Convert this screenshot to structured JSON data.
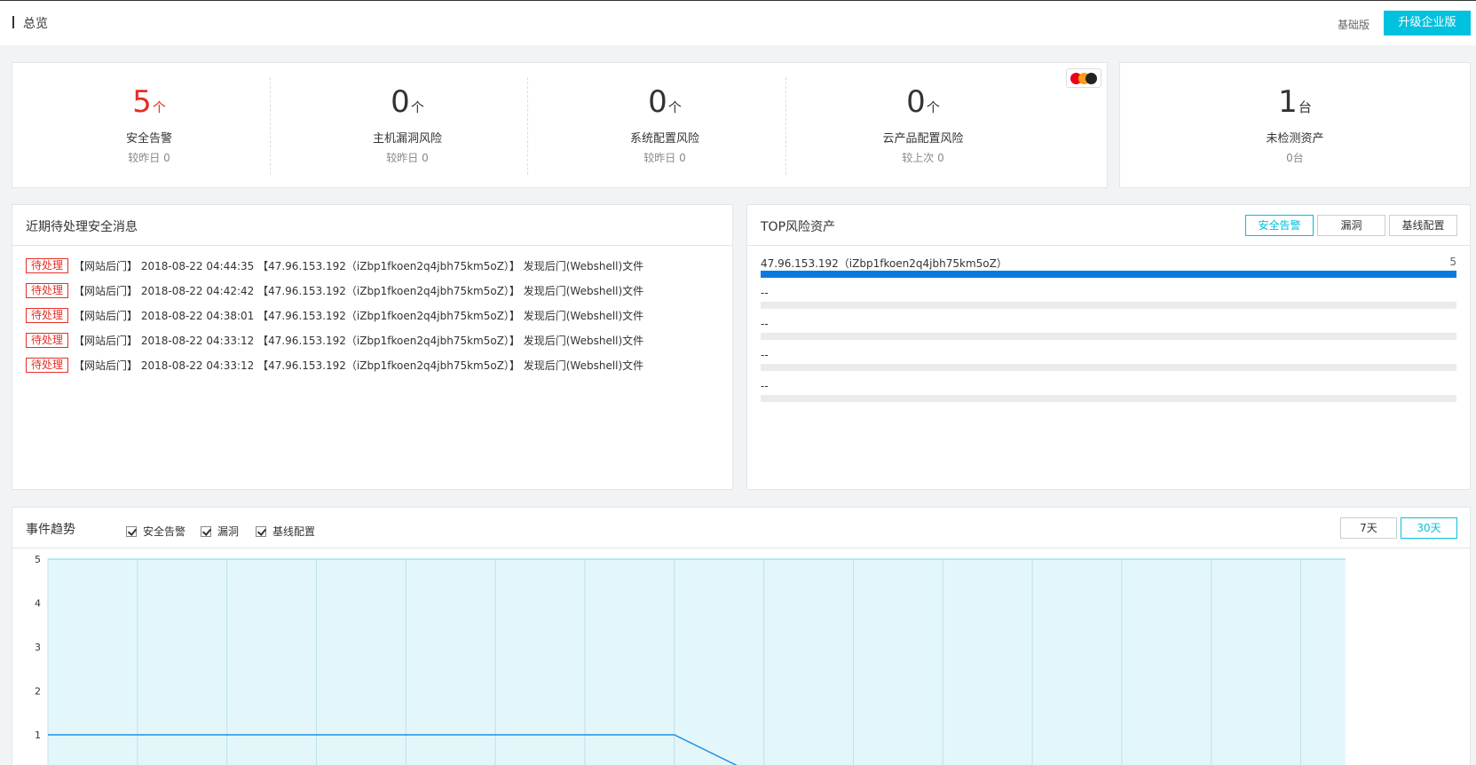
{
  "header": {
    "title": "总览",
    "edition": "基础版",
    "upgrade_label": "升级企业版"
  },
  "stats": [
    {
      "value": "5",
      "unit": "个",
      "label": "安全告警",
      "sub": "较昨日 0",
      "highlight": true
    },
    {
      "value": "0",
      "unit": "个",
      "label": "主机漏洞风险",
      "sub": "较昨日 0",
      "highlight": false
    },
    {
      "value": "0",
      "unit": "个",
      "label": "系统配置风险",
      "sub": "较昨日 0",
      "highlight": false
    },
    {
      "value": "0",
      "unit": "个",
      "label": "云产品配置风险",
      "sub": "较上次 0",
      "highlight": false
    }
  ],
  "unchecked": {
    "value": "1",
    "unit": "台",
    "label": "未检测资产",
    "sub": "0台"
  },
  "messages": {
    "title": "近期待处理安全消息",
    "items": [
      {
        "tag": "待处理",
        "text": "【网站后门】 2018-08-22 04:44:35 【47.96.153.192（iZbp1fkoen2q4jbh75km5oZ）】 发现后门(Webshell)文件"
      },
      {
        "tag": "待处理",
        "text": "【网站后门】 2018-08-22 04:42:42 【47.96.153.192（iZbp1fkoen2q4jbh75km5oZ）】 发现后门(Webshell)文件"
      },
      {
        "tag": "待处理",
        "text": "【网站后门】 2018-08-22 04:38:01 【47.96.153.192（iZbp1fkoen2q4jbh75km5oZ）】 发现后门(Webshell)文件"
      },
      {
        "tag": "待处理",
        "text": "【网站后门】 2018-08-22 04:33:12 【47.96.153.192（iZbp1fkoen2q4jbh75km5oZ）】 发现后门(Webshell)文件"
      },
      {
        "tag": "待处理",
        "text": "【网站后门】 2018-08-22 04:33:12 【47.96.153.192（iZbp1fkoen2q4jbh75km5oZ）】 发现后门(Webshell)文件"
      }
    ]
  },
  "top_risk": {
    "title": "TOP风险资产",
    "tabs": [
      "安全告警",
      "漏洞",
      "基线配置"
    ],
    "active_tab": 0,
    "rows": [
      {
        "name": "47.96.153.192（iZbp1fkoen2q4jbh75km5oZ）",
        "count": "5",
        "fraction": 1.0
      },
      {
        "name": "--",
        "count": "",
        "fraction": 0
      },
      {
        "name": "--",
        "count": "",
        "fraction": 0
      },
      {
        "name": "--",
        "count": "",
        "fraction": 0
      },
      {
        "name": "--",
        "count": "",
        "fraction": 0
      }
    ]
  },
  "trend": {
    "title": "事件趋势",
    "legend": [
      "安全告警",
      "漏洞",
      "基线配置"
    ],
    "ranges": [
      "7天",
      "30天"
    ],
    "active_range": 1
  },
  "colors": {
    "accent": "#00c1de",
    "alert_red": "#e62e25",
    "bar_blue": "#0b7ae0",
    "chart_fill": "#e3f7fb",
    "chart_line": "#1f8fe0"
  },
  "chart_data": {
    "type": "line",
    "yticks": [
      "5",
      "4",
      "3",
      "2",
      "1"
    ],
    "ylim": [
      0,
      5
    ],
    "series": [
      {
        "name": "安全告警",
        "values": [
          1,
          1,
          1,
          1,
          1,
          1,
          1,
          1,
          0,
          0,
          0,
          0,
          0,
          0,
          0
        ]
      }
    ]
  }
}
